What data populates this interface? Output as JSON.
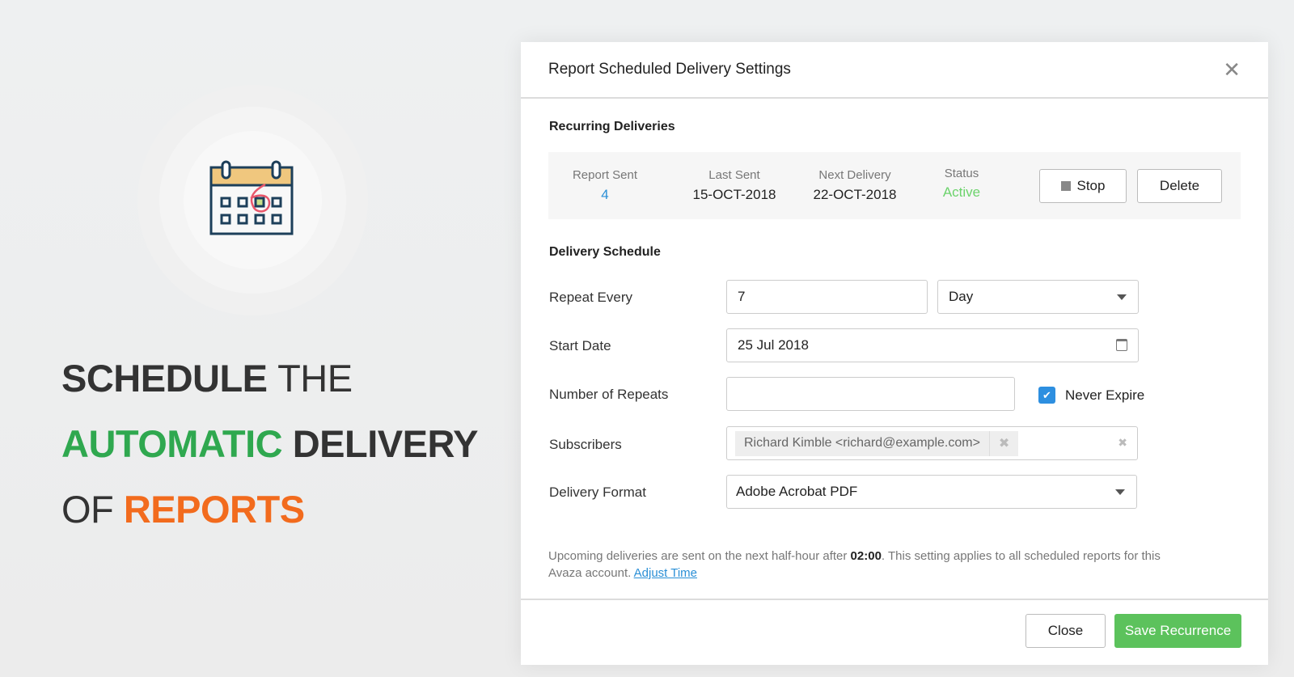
{
  "promo": {
    "line1_bold": "SCHEDULE",
    "line1_thin": "THE",
    "line2_green": "AUTOMATIC",
    "line2_dark": "DELIVERY",
    "line3_thin": "OF",
    "line3_orange": "REPORTS"
  },
  "modal": {
    "title": "Report Scheduled Delivery Settings",
    "recurring": {
      "heading": "Recurring Deliveries",
      "report_sent_label": "Report Sent",
      "report_sent": "4",
      "last_sent_label": "Last Sent",
      "last_sent": "15-OCT-2018",
      "next_delivery_label": "Next Delivery",
      "next_delivery": "22-OCT-2018",
      "status_label": "Status",
      "status": "Active",
      "stop": "Stop",
      "delete": "Delete"
    },
    "schedule": {
      "heading": "Delivery Schedule",
      "repeat_every_label": "Repeat Every",
      "repeat_every": "7",
      "repeat_unit": "Day",
      "start_date_label": "Start Date",
      "start_date": "25 Jul 2018",
      "repeats_label": "Number of Repeats",
      "repeats": "",
      "never_expire": "Never Expire",
      "never_expire_checked": true,
      "subscribers_label": "Subscribers",
      "subscriber": "Richard Kimble <richard@example.com>",
      "format_label": "Delivery Format",
      "format": "Adobe Acrobat PDF"
    },
    "note": {
      "text1": "Upcoming deliveries are sent on the next half-hour after ",
      "time": "02:00",
      "text2": ". This setting applies to all scheduled reports for this Avaza account. ",
      "link": "Adjust Time"
    },
    "footer": {
      "close": "Close",
      "save": "Save Recurrence"
    }
  },
  "colors": {
    "green": "#2fa84f",
    "orange": "#f26b1d",
    "save": "#5cc25c",
    "active": "#6cd36c",
    "link": "#2a8fd6",
    "checkbox": "#2d8fe0"
  }
}
